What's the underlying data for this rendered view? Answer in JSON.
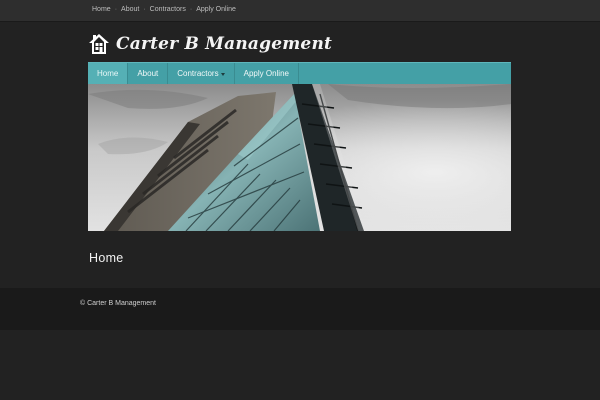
{
  "top_nav": {
    "items": [
      "Home",
      "About",
      "Contractors",
      "Apply Online"
    ],
    "separator": "·"
  },
  "brand": {
    "title": "Carter B Management",
    "icon": "house-icon"
  },
  "main_nav": {
    "items": [
      {
        "label": "Home",
        "active": true
      },
      {
        "label": "About",
        "active": false
      },
      {
        "label": "Contractors",
        "active": false,
        "dropdown": true
      },
      {
        "label": "Apply Online",
        "active": false
      }
    ]
  },
  "hero": {
    "icon": "building-photo"
  },
  "page": {
    "heading": "Home"
  },
  "footer": {
    "copyright": "© Carter B Management"
  },
  "colors": {
    "background": "#222222",
    "topbar": "#2e2e2e",
    "nav_accent": "#44a0a6",
    "nav_active": "#55b0b5",
    "footer": "#1a1a1a"
  }
}
